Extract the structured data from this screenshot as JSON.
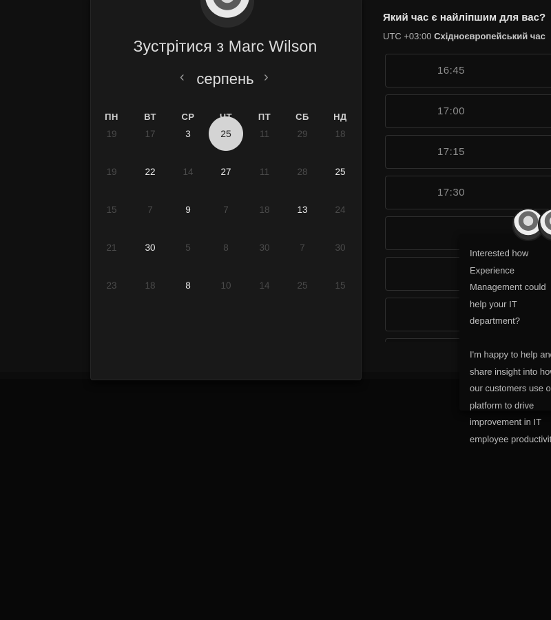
{
  "calendar": {
    "title": "Зустрітися з Marc Wilson",
    "month": "серпень",
    "prev_symbol": "‹",
    "next_symbol": "›",
    "weekdays": [
      "ПН",
      "ВТ",
      "СР",
      "ЧТ",
      "ПТ",
      "СБ",
      "НД"
    ],
    "weeks": [
      [
        "19",
        "17",
        "3",
        "25",
        "11",
        "29",
        "18"
      ],
      [
        "19",
        "22",
        "14",
        "27",
        "11",
        "28",
        "25"
      ],
      [
        "15",
        "7",
        "9",
        "7",
        "18",
        "13",
        "24"
      ],
      [
        "21",
        "30",
        "5",
        "8",
        "30",
        "7",
        "30"
      ],
      [
        "23",
        "18",
        "8",
        "10",
        "14",
        "25",
        "15"
      ]
    ],
    "available": [
      [
        false,
        false,
        true,
        true,
        false,
        false,
        false
      ],
      [
        false,
        true,
        false,
        true,
        false,
        false,
        true
      ],
      [
        false,
        false,
        true,
        false,
        false,
        true,
        false
      ],
      [
        false,
        true,
        false,
        false,
        false,
        false,
        false
      ],
      [
        false,
        false,
        true,
        false,
        false,
        false,
        false
      ]
    ],
    "selected": "25"
  },
  "times": {
    "question": "Який час є найліпшим для вас?",
    "tz_offset": "UTC +03:00",
    "tz_name": "Східноєвропейський час",
    "slots": [
      "16:45",
      "17:00",
      "17:15",
      "17:30",
      "",
      "",
      "",
      ""
    ]
  },
  "chat": {
    "message": "Interested how Experience Management could help your IT department?\n\nI'm happy to help and share insight into how our customers use our platform to drive improvement in IT employee productivity."
  }
}
